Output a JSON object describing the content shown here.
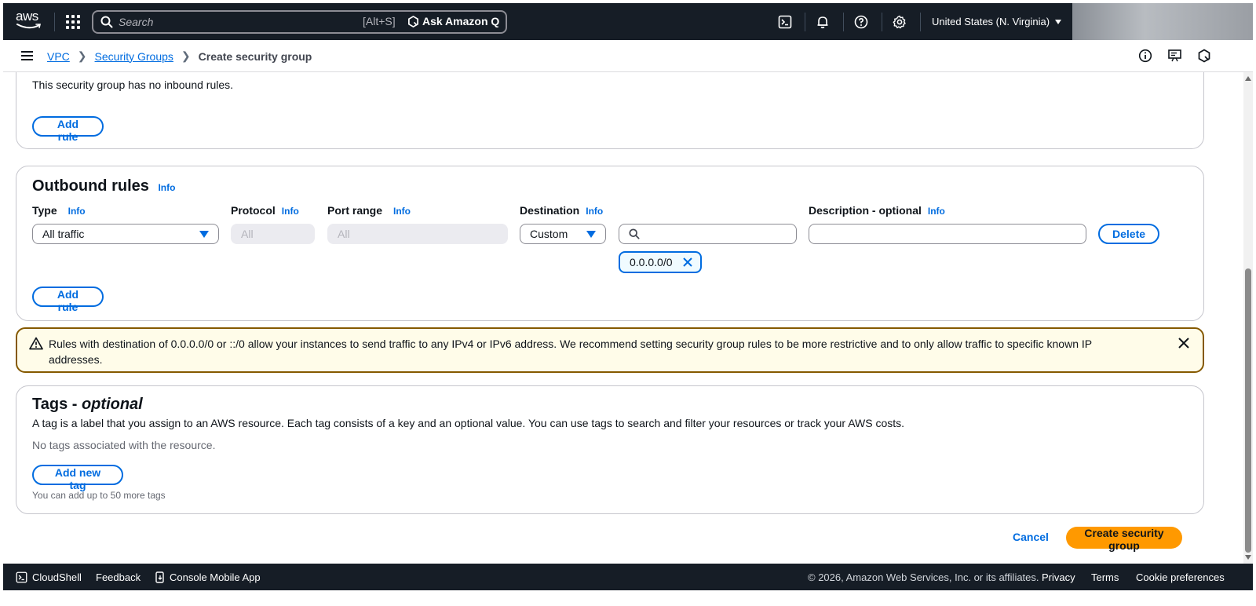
{
  "topnav": {
    "logo_text": "aws",
    "search_placeholder": "Search",
    "search_shortcut": "[Alt+S]",
    "ask_q_label": "Ask Amazon Q",
    "region_label": "United States (N. Virginia)",
    "icons": [
      "cloudshell-icon",
      "bell-icon",
      "help-icon",
      "gear-icon"
    ]
  },
  "breadcrumb": {
    "items": [
      "VPC",
      "Security Groups"
    ],
    "current": "Create security group"
  },
  "inbound": {
    "empty_text": "This security group has no inbound rules.",
    "add_rule_label": "Add rule"
  },
  "outbound": {
    "title": "Outbound rules",
    "info_label": "Info",
    "columns": {
      "type": "Type",
      "protocol": "Protocol",
      "port_range": "Port range",
      "destination": "Destination",
      "description": "Description - optional"
    },
    "rule": {
      "type_value": "All traffic",
      "protocol_value": "All",
      "port_range_value": "All",
      "destination_type": "Custom",
      "destination_search_value": "",
      "destination_token": "0.0.0.0/0",
      "description_value": ""
    },
    "delete_label": "Delete",
    "add_rule_label": "Add rule"
  },
  "alert": {
    "message": "Rules with destination of 0.0.0.0/0 or ::/0 allow your instances to send traffic to any IPv4 or IPv6 address. We recommend setting security group rules to be more restrictive and to only allow traffic to specific known IP addresses."
  },
  "tags": {
    "title_main": "Tags - ",
    "title_italic": "optional",
    "description": "A tag is a label that you assign to an AWS resource. Each tag consists of a key and an optional value. You can use tags to search and filter your resources or track your AWS costs.",
    "empty_text": "No tags associated with the resource.",
    "add_tag_label": "Add new tag",
    "limit_text": "You can add up to 50 more tags"
  },
  "actions": {
    "cancel_label": "Cancel",
    "create_label": "Create security group"
  },
  "footer": {
    "cloudshell": "CloudShell",
    "feedback": "Feedback",
    "mobile_app": "Console Mobile App",
    "copyright": "© 2026, Amazon Web Services, Inc. or its affiliates.",
    "privacy": "Privacy",
    "terms": "Terms",
    "cookie": "Cookie preferences"
  },
  "colors": {
    "nav_bg": "#161d26",
    "link_blue": "#006ce0",
    "primary_orange": "#ff9900",
    "warning_border": "#855900",
    "warning_bg": "#fffce9"
  }
}
